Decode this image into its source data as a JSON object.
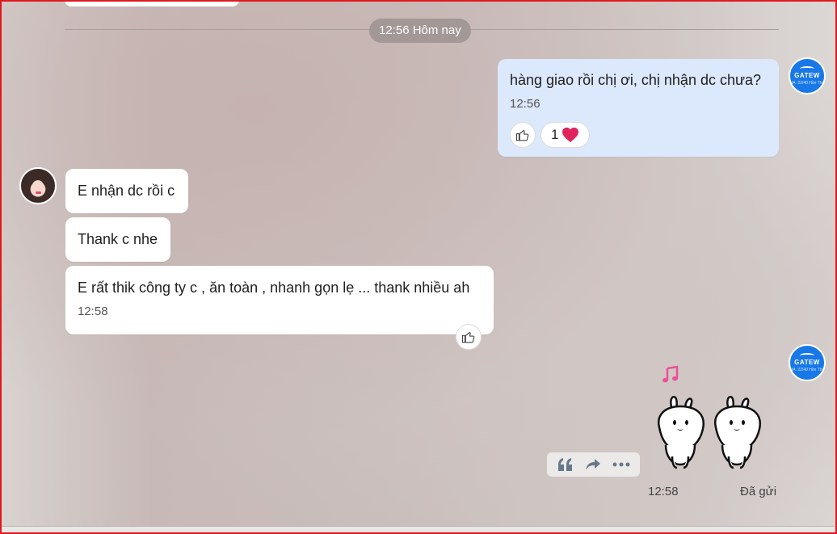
{
  "divider": {
    "label": "12:56 Hôm nay"
  },
  "messages": [
    {
      "id": "m1",
      "sender": "me",
      "text": "hàng giao rồi chị ơi, chị nhận dc chưa?",
      "time": "12:56",
      "reaction_count": "1"
    },
    {
      "id": "m2",
      "sender": "other",
      "text": "E nhận dc rồi c"
    },
    {
      "id": "m3",
      "sender": "other",
      "text": "Thank c nhe"
    },
    {
      "id": "m4",
      "sender": "other",
      "text": "E rất thik công ty c , ăn toàn , nhanh gọn lẹ ... thank nhiều ah",
      "time": "12:58"
    }
  ],
  "sticker": {
    "time": "12:58",
    "status": "Đã gửi",
    "icon": "music-note-icon"
  },
  "company_avatar": {
    "brand": "GATEW",
    "sub": "HA: 22/40 Hồn Thổ",
    "color": "#1878e8"
  },
  "colors": {
    "my_bubble": "#dce8fb",
    "other_bubble": "#ffffff",
    "accent_heart": "#e0245e",
    "frame_border": "#e0191f"
  },
  "icons": [
    "like-icon",
    "heart-icon",
    "quote-icon",
    "forward-icon",
    "more-icon"
  ]
}
